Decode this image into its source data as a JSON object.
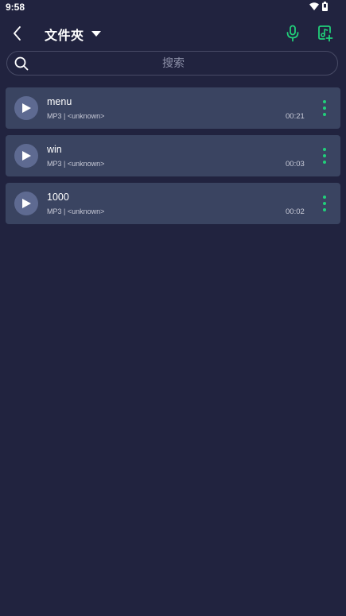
{
  "status_bar": {
    "time": "9:58",
    "icons": [
      "wifi-icon",
      "battery-icon"
    ]
  },
  "header": {
    "title": "文件夾",
    "back_icon": "chevron-left-icon",
    "dropdown_icon": "caret-down-icon",
    "mic_icon": "microphone-icon",
    "add_icon": "add-music-icon"
  },
  "search": {
    "placeholder": "搜索",
    "value": ""
  },
  "tracks": [
    {
      "title": "menu",
      "meta": "MP3 | <unknown>",
      "duration": "00:21"
    },
    {
      "title": "win",
      "meta": "MP3 | <unknown>",
      "duration": "00:03"
    },
    {
      "title": "1000",
      "meta": "MP3 | <unknown>",
      "duration": "00:02"
    }
  ],
  "colors": {
    "background": "#21233f",
    "card": "#3a4461",
    "play_button": "#5e6a91",
    "accent_green": "#21d07a",
    "secondary_text": "#c9cbd8"
  }
}
